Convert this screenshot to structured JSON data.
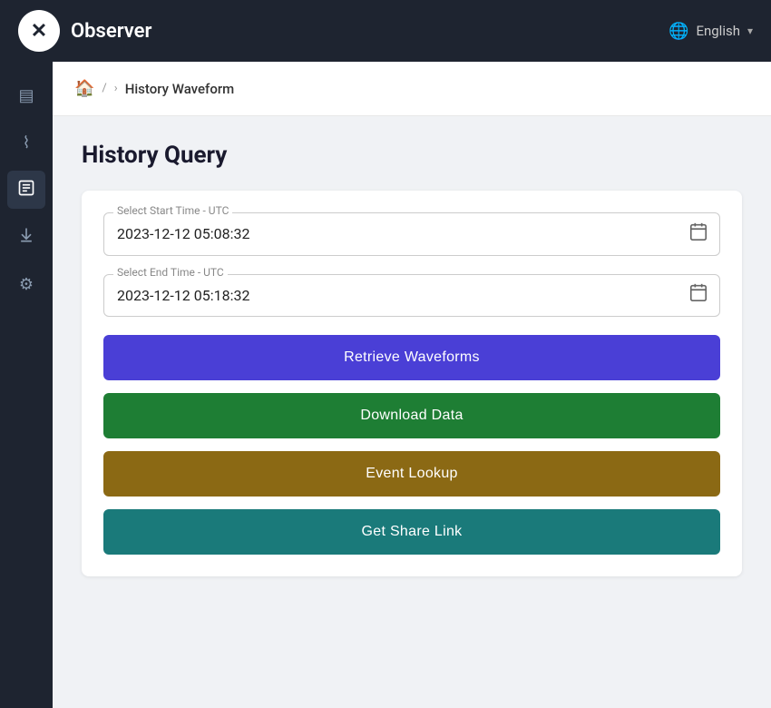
{
  "header": {
    "logo_symbol": "✕",
    "app_title": "Observer",
    "language_label": "English"
  },
  "sidebar": {
    "items": [
      {
        "icon": "▤",
        "name": "dashboard",
        "active": false
      },
      {
        "icon": "⌇",
        "name": "waveform",
        "active": false
      },
      {
        "icon": "📋",
        "name": "reports",
        "active": true
      },
      {
        "icon": "⬇",
        "name": "download",
        "active": false
      },
      {
        "icon": "⚙",
        "name": "settings",
        "active": false
      }
    ]
  },
  "breadcrumb": {
    "home_icon": "🏠",
    "separator1": "/",
    "separator2": "›",
    "current_page": "History Waveform"
  },
  "page": {
    "title": "History Query",
    "start_time_label": "Select Start Time - UTC",
    "start_time_value": "2023-12-12 05:08:32",
    "end_time_label": "Select End Time - UTC",
    "end_time_value": "2023-12-12 05:18:32",
    "btn_retrieve": "Retrieve Waveforms",
    "btn_download": "Download Data",
    "btn_event": "Event Lookup",
    "btn_share": "Get Share Link"
  },
  "colors": {
    "sidebar_bg": "#1e2430",
    "btn_retrieve": "#4a3fd6",
    "btn_download": "#1e7e34",
    "btn_event": "#8b6914",
    "btn_share": "#1a7a7a"
  }
}
